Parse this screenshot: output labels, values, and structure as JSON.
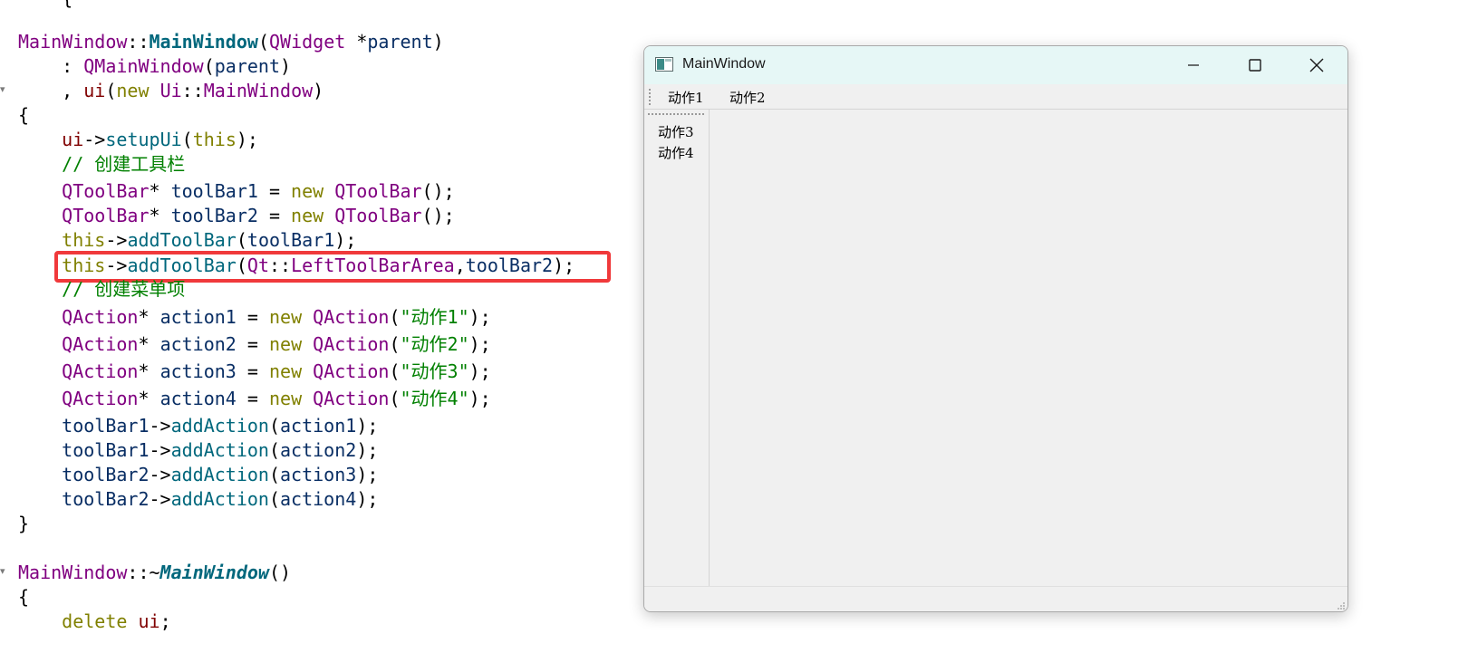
{
  "editor": {
    "lines": [
      {
        "id": "l0",
        "parts": [
          {
            "c": "c-plain",
            "t": "    {"
          }
        ]
      },
      {
        "id": "l1",
        "parts": [
          {
            "c": "c-cls",
            "t": "MainWindow"
          },
          {
            "c": "c-plain",
            "t": "::"
          },
          {
            "c": "c-fnb",
            "t": "MainWindow"
          },
          {
            "c": "c-plain",
            "t": "("
          },
          {
            "c": "c-cls",
            "t": "QWidget"
          },
          {
            "c": "c-plain",
            "t": " *"
          },
          {
            "c": "c-var",
            "t": "parent"
          },
          {
            "c": "c-plain",
            "t": ")"
          }
        ]
      },
      {
        "id": "l2",
        "parts": [
          {
            "c": "c-plain",
            "t": "    : "
          },
          {
            "c": "c-cls",
            "t": "QMainWindow"
          },
          {
            "c": "c-plain",
            "t": "("
          },
          {
            "c": "c-var",
            "t": "parent"
          },
          {
            "c": "c-plain",
            "t": ")"
          }
        ]
      },
      {
        "id": "l3",
        "parts": [
          {
            "c": "c-plain",
            "t": "    , "
          },
          {
            "c": "c-mem",
            "t": "ui"
          },
          {
            "c": "c-plain",
            "t": "("
          },
          {
            "c": "c-kw",
            "t": "new"
          },
          {
            "c": "c-plain",
            "t": " "
          },
          {
            "c": "c-cls",
            "t": "Ui"
          },
          {
            "c": "c-plain",
            "t": "::"
          },
          {
            "c": "c-cls",
            "t": "MainWindow"
          },
          {
            "c": "c-plain",
            "t": ")"
          }
        ]
      },
      {
        "id": "l4",
        "parts": [
          {
            "c": "c-plain",
            "t": "{"
          }
        ]
      },
      {
        "id": "l5",
        "parts": [
          {
            "c": "c-plain",
            "t": "    "
          },
          {
            "c": "c-mem",
            "t": "ui"
          },
          {
            "c": "c-plain",
            "t": "->"
          },
          {
            "c": "c-fn",
            "t": "setupUi"
          },
          {
            "c": "c-plain",
            "t": "("
          },
          {
            "c": "c-kw",
            "t": "this"
          },
          {
            "c": "c-plain",
            "t": ");"
          }
        ]
      },
      {
        "id": "l6",
        "parts": [
          {
            "c": "c-com",
            "t": "    // 创建工具栏"
          }
        ]
      },
      {
        "id": "l7",
        "parts": [
          {
            "c": "c-plain",
            "t": "    "
          },
          {
            "c": "c-cls",
            "t": "QToolBar"
          },
          {
            "c": "c-plain",
            "t": "* "
          },
          {
            "c": "c-var",
            "t": "toolBar1"
          },
          {
            "c": "c-plain",
            "t": " = "
          },
          {
            "c": "c-kw",
            "t": "new"
          },
          {
            "c": "c-plain",
            "t": " "
          },
          {
            "c": "c-cls",
            "t": "QToolBar"
          },
          {
            "c": "c-plain",
            "t": "();"
          }
        ]
      },
      {
        "id": "l8",
        "parts": [
          {
            "c": "c-plain",
            "t": "    "
          },
          {
            "c": "c-cls",
            "t": "QToolBar"
          },
          {
            "c": "c-plain",
            "t": "* "
          },
          {
            "c": "c-var",
            "t": "toolBar2"
          },
          {
            "c": "c-plain",
            "t": " = "
          },
          {
            "c": "c-kw",
            "t": "new"
          },
          {
            "c": "c-plain",
            "t": " "
          },
          {
            "c": "c-cls",
            "t": "QToolBar"
          },
          {
            "c": "c-plain",
            "t": "();"
          }
        ]
      },
      {
        "id": "l9",
        "parts": [
          {
            "c": "c-plain",
            "t": "    "
          },
          {
            "c": "c-kw",
            "t": "this"
          },
          {
            "c": "c-plain",
            "t": "->"
          },
          {
            "c": "c-fn",
            "t": "addToolBar"
          },
          {
            "c": "c-plain",
            "t": "("
          },
          {
            "c": "c-var",
            "t": "toolBar1"
          },
          {
            "c": "c-plain",
            "t": ");"
          }
        ]
      },
      {
        "id": "l10",
        "parts": [
          {
            "c": "c-plain",
            "t": "    "
          },
          {
            "c": "c-kw",
            "t": "this"
          },
          {
            "c": "c-plain",
            "t": "->"
          },
          {
            "c": "c-fn",
            "t": "addToolBar"
          },
          {
            "c": "c-plain",
            "t": "("
          },
          {
            "c": "c-cls",
            "t": "Qt"
          },
          {
            "c": "c-plain",
            "t": "::"
          },
          {
            "c": "c-cn",
            "t": "LeftToolBarArea"
          },
          {
            "c": "c-plain",
            "t": ","
          },
          {
            "c": "c-var",
            "t": "toolBar2"
          },
          {
            "c": "c-plain",
            "t": ");"
          }
        ]
      },
      {
        "id": "l11",
        "parts": [
          {
            "c": "c-com",
            "t": "    // 创建菜单项"
          }
        ]
      },
      {
        "id": "l12",
        "parts": [
          {
            "c": "c-plain",
            "t": "    "
          },
          {
            "c": "c-cls",
            "t": "QAction"
          },
          {
            "c": "c-plain",
            "t": "* "
          },
          {
            "c": "c-var",
            "t": "action1"
          },
          {
            "c": "c-plain",
            "t": " = "
          },
          {
            "c": "c-kw",
            "t": "new"
          },
          {
            "c": "c-plain",
            "t": " "
          },
          {
            "c": "c-cls",
            "t": "QAction"
          },
          {
            "c": "c-plain",
            "t": "("
          },
          {
            "c": "c-str",
            "t": "\"动作1\""
          },
          {
            "c": "c-plain",
            "t": ");"
          }
        ]
      },
      {
        "id": "l13",
        "parts": [
          {
            "c": "c-plain",
            "t": "    "
          },
          {
            "c": "c-cls",
            "t": "QAction"
          },
          {
            "c": "c-plain",
            "t": "* "
          },
          {
            "c": "c-var",
            "t": "action2"
          },
          {
            "c": "c-plain",
            "t": " = "
          },
          {
            "c": "c-kw",
            "t": "new"
          },
          {
            "c": "c-plain",
            "t": " "
          },
          {
            "c": "c-cls",
            "t": "QAction"
          },
          {
            "c": "c-plain",
            "t": "("
          },
          {
            "c": "c-str",
            "t": "\"动作2\""
          },
          {
            "c": "c-plain",
            "t": ");"
          }
        ]
      },
      {
        "id": "l14",
        "parts": [
          {
            "c": "c-plain",
            "t": "    "
          },
          {
            "c": "c-cls",
            "t": "QAction"
          },
          {
            "c": "c-plain",
            "t": "* "
          },
          {
            "c": "c-var",
            "t": "action3"
          },
          {
            "c": "c-plain",
            "t": " = "
          },
          {
            "c": "c-kw",
            "t": "new"
          },
          {
            "c": "c-plain",
            "t": " "
          },
          {
            "c": "c-cls",
            "t": "QAction"
          },
          {
            "c": "c-plain",
            "t": "("
          },
          {
            "c": "c-str",
            "t": "\"动作3\""
          },
          {
            "c": "c-plain",
            "t": ");"
          }
        ]
      },
      {
        "id": "l15",
        "parts": [
          {
            "c": "c-plain",
            "t": "    "
          },
          {
            "c": "c-cls",
            "t": "QAction"
          },
          {
            "c": "c-plain",
            "t": "* "
          },
          {
            "c": "c-var",
            "t": "action4"
          },
          {
            "c": "c-plain",
            "t": " = "
          },
          {
            "c": "c-kw",
            "t": "new"
          },
          {
            "c": "c-plain",
            "t": " "
          },
          {
            "c": "c-cls",
            "t": "QAction"
          },
          {
            "c": "c-plain",
            "t": "("
          },
          {
            "c": "c-str",
            "t": "\"动作4\""
          },
          {
            "c": "c-plain",
            "t": ");"
          }
        ]
      },
      {
        "id": "l16",
        "parts": [
          {
            "c": "c-plain",
            "t": "    "
          },
          {
            "c": "c-var",
            "t": "toolBar1"
          },
          {
            "c": "c-plain",
            "t": "->"
          },
          {
            "c": "c-fn",
            "t": "addAction"
          },
          {
            "c": "c-plain",
            "t": "("
          },
          {
            "c": "c-var",
            "t": "action1"
          },
          {
            "c": "c-plain",
            "t": ");"
          }
        ]
      },
      {
        "id": "l17",
        "parts": [
          {
            "c": "c-plain",
            "t": "    "
          },
          {
            "c": "c-var",
            "t": "toolBar1"
          },
          {
            "c": "c-plain",
            "t": "->"
          },
          {
            "c": "c-fn",
            "t": "addAction"
          },
          {
            "c": "c-plain",
            "t": "("
          },
          {
            "c": "c-var",
            "t": "action2"
          },
          {
            "c": "c-plain",
            "t": ");"
          }
        ]
      },
      {
        "id": "l18",
        "parts": [
          {
            "c": "c-plain",
            "t": "    "
          },
          {
            "c": "c-var",
            "t": "toolBar2"
          },
          {
            "c": "c-plain",
            "t": "->"
          },
          {
            "c": "c-fn",
            "t": "addAction"
          },
          {
            "c": "c-plain",
            "t": "("
          },
          {
            "c": "c-var",
            "t": "action3"
          },
          {
            "c": "c-plain",
            "t": ");"
          }
        ]
      },
      {
        "id": "l19",
        "parts": [
          {
            "c": "c-plain",
            "t": "    "
          },
          {
            "c": "c-var",
            "t": "toolBar2"
          },
          {
            "c": "c-plain",
            "t": "->"
          },
          {
            "c": "c-fn",
            "t": "addAction"
          },
          {
            "c": "c-plain",
            "t": "("
          },
          {
            "c": "c-var",
            "t": "action4"
          },
          {
            "c": "c-plain",
            "t": ");"
          }
        ]
      },
      {
        "id": "l20",
        "parts": [
          {
            "c": "c-plain",
            "t": "}"
          }
        ]
      },
      {
        "id": "l21",
        "parts": [
          {
            "c": "c-cls",
            "t": "MainWindow"
          },
          {
            "c": "c-plain",
            "t": "::~"
          },
          {
            "c": "c-fnbi",
            "t": "MainWindow"
          },
          {
            "c": "c-plain",
            "t": "()"
          }
        ]
      },
      {
        "id": "l22",
        "parts": [
          {
            "c": "c-plain",
            "t": "{"
          }
        ]
      },
      {
        "id": "l23",
        "parts": [
          {
            "c": "c-plain",
            "t": "    "
          },
          {
            "c": "c-kw",
            "t": "delete"
          },
          {
            "c": "c-plain",
            "t": " "
          },
          {
            "c": "c-mem",
            "t": "ui"
          },
          {
            "c": "c-plain",
            "t": ";"
          }
        ]
      }
    ],
    "fold_markers": [
      "▾",
      "▾"
    ]
  },
  "qt_window": {
    "title": "MainWindow",
    "top_toolbar": {
      "action1": "动作1",
      "action2": "动作2"
    },
    "left_toolbar": {
      "action3": "动作3",
      "action4": "动作4"
    }
  },
  "colors": {
    "highlight_box": "#f0393b",
    "titlebar_bg": "#e6f7f6",
    "window_bg": "#f0f0f0"
  }
}
